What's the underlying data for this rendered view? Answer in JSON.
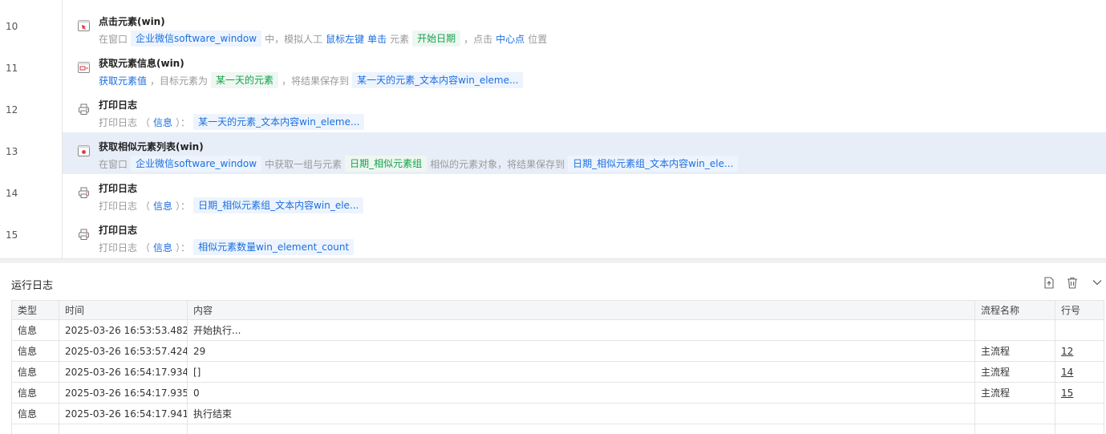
{
  "steps": [
    {
      "line": "10",
      "icon": "click-element-icon",
      "title": "点击元素(win)",
      "selected": false,
      "desc": [
        {
          "k": "t",
          "v": "在窗口"
        },
        {
          "k": "chip",
          "v": "企业微信software_window"
        },
        {
          "k": "t",
          "v": "中，模拟人工"
        },
        {
          "k": "plain",
          "v": "鼠标左键"
        },
        {
          "k": "plain",
          "v": "单击"
        },
        {
          "k": "t",
          "v": "元素"
        },
        {
          "k": "chip-green",
          "v": "开始日期"
        },
        {
          "k": "t",
          "v": "，点击"
        },
        {
          "k": "plain",
          "v": "中心点"
        },
        {
          "k": "t",
          "v": "位置"
        }
      ]
    },
    {
      "line": "11",
      "icon": "get-element-info-icon",
      "title": "获取元素信息(win)",
      "selected": false,
      "desc": [
        {
          "k": "plain",
          "v": "获取元素值"
        },
        {
          "k": "t",
          "v": "，目标元素为"
        },
        {
          "k": "chip-green",
          "v": "某一天的元素"
        },
        {
          "k": "t",
          "v": "，将结果保存到"
        },
        {
          "k": "chip",
          "v": "某一天的元素_文本内容win_eleme..."
        }
      ]
    },
    {
      "line": "12",
      "icon": "print-log-icon",
      "title": "打印日志",
      "selected": false,
      "desc": [
        {
          "k": "t",
          "v": "打印日志"
        },
        {
          "k": "paren",
          "v": "（"
        },
        {
          "k": "plain",
          "v": "信息"
        },
        {
          "k": "paren",
          "v": "）："
        },
        {
          "k": "chip",
          "v": "某一天的元素_文本内容win_eleme..."
        }
      ]
    },
    {
      "line": "13",
      "icon": "get-similar-elements-icon",
      "title": "获取相似元素列表(win)",
      "selected": true,
      "desc": [
        {
          "k": "t",
          "v": "在窗口"
        },
        {
          "k": "chip",
          "v": "企业微信software_window"
        },
        {
          "k": "t",
          "v": "中获取一组与元素"
        },
        {
          "k": "chip-green",
          "v": "日期_相似元素组"
        },
        {
          "k": "t",
          "v": "相似的元素对象，将结果保存到"
        },
        {
          "k": "chip",
          "v": "日期_相似元素组_文本内容win_ele..."
        }
      ]
    },
    {
      "line": "14",
      "icon": "print-log-icon",
      "title": "打印日志",
      "selected": false,
      "desc": [
        {
          "k": "t",
          "v": "打印日志"
        },
        {
          "k": "paren",
          "v": "（"
        },
        {
          "k": "plain",
          "v": "信息"
        },
        {
          "k": "paren",
          "v": "）："
        },
        {
          "k": "chip",
          "v": "日期_相似元素组_文本内容win_ele..."
        }
      ]
    },
    {
      "line": "15",
      "icon": "print-log-icon",
      "title": "打印日志",
      "selected": false,
      "desc": [
        {
          "k": "t",
          "v": "打印日志"
        },
        {
          "k": "paren",
          "v": "（"
        },
        {
          "k": "plain",
          "v": "信息"
        },
        {
          "k": "paren",
          "v": "）："
        },
        {
          "k": "chip",
          "v": "相似元素数量win_element_count"
        }
      ]
    }
  ],
  "log": {
    "title": "运行日志",
    "tools": [
      "export-icon",
      "delete-icon",
      "collapse-chevron-icon"
    ],
    "columns": [
      "类型",
      "时间",
      "内容",
      "流程名称",
      "行号"
    ],
    "rows": [
      {
        "type": "信息",
        "time": "2025-03-26 16:53:53.482",
        "content": "开始执行...",
        "flow": "",
        "line": ""
      },
      {
        "type": "信息",
        "time": "2025-03-26 16:53:57.424",
        "content": "29",
        "flow": "主流程",
        "line": "12"
      },
      {
        "type": "信息",
        "time": "2025-03-26 16:54:17.934",
        "content": "[]",
        "flow": "主流程",
        "line": "14"
      },
      {
        "type": "信息",
        "time": "2025-03-26 16:54:17.935",
        "content": "0",
        "flow": "主流程",
        "line": "15"
      },
      {
        "type": "信息",
        "time": "2025-03-26 16:54:17.941",
        "content": "执行结束",
        "flow": "",
        "line": ""
      }
    ]
  },
  "colors": {
    "accent_blue": "#1d6fe0",
    "accent_green": "#13a24a",
    "selected_row": "#e8eef8",
    "icon_red": "#d9363e"
  }
}
